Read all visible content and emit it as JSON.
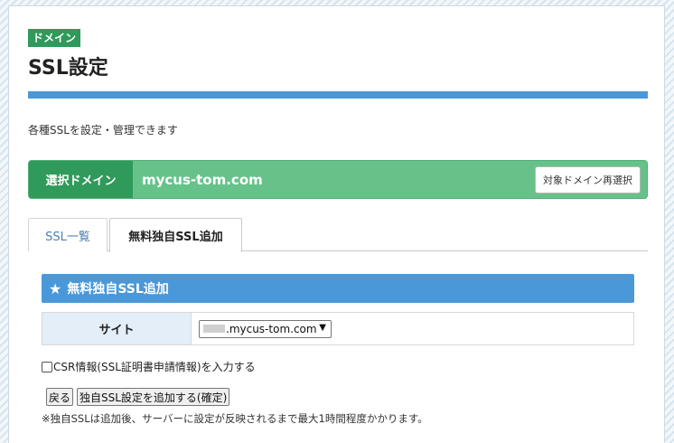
{
  "header": {
    "category_badge": "ドメイン",
    "title": "SSL設定",
    "description": "各種SSLを設定・管理できます"
  },
  "domain_bar": {
    "label": "選択ドメイン",
    "domain": "mycus-tom.com",
    "reselect_button": "対象ドメイン再選択"
  },
  "tabs": [
    {
      "label": "SSL一覧",
      "active": false
    },
    {
      "label": "無料独自SSL追加",
      "active": true
    }
  ],
  "section": {
    "icon": "star-icon",
    "title": "無料独自SSL追加"
  },
  "form": {
    "site_label": "サイト",
    "site_select_value": ".mycus-tom.com",
    "csr_checkbox_label": "CSR情報(SSL証明書申請情報)を入力する",
    "csr_checked": false
  },
  "buttons": {
    "back": "戻る",
    "confirm": "独自SSL設定を追加する(確定)"
  },
  "note": "※独自SSLは追加後、サーバーに設定が反映されるまで最大1時間程度かかります。",
  "colors": {
    "accent_blue": "#4a98d8",
    "brand_green": "#2f9a5a",
    "domain_bar_green": "#67c28a"
  }
}
